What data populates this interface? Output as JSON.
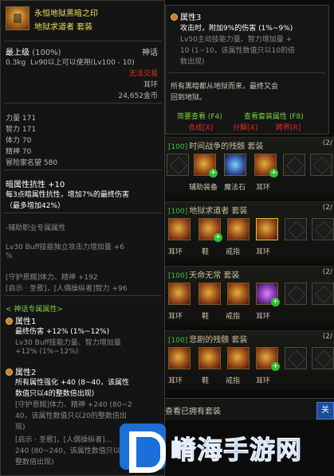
{
  "tooltip": {
    "name": "永恒地狱黑暗之印",
    "set_name": "地狱求道者  套装",
    "grade": "最上级",
    "grade_pct": "(100%)",
    "rarity": "神话",
    "weight": "0.3kg",
    "level_req": "Lv90以上可以使用(Lv100 - 10)",
    "trade": "无法交易",
    "slot_type": "耳环",
    "price": "24,652金币",
    "stats": [
      {
        "label": "力量",
        "value": "171"
      },
      {
        "label": "智力",
        "value": "171"
      },
      {
        "label": "体力",
        "value": "70"
      },
      {
        "label": "精神",
        "value": "70"
      },
      {
        "label": "冒险家名望",
        "value": "580"
      }
    ],
    "dark_res": "暗属性抗性 +10",
    "dark_desc1": "每3点暗属性抗性，增加7%的最终伤害",
    "dark_desc2": "（最多增加42%）",
    "job_header": "-辅助职业专属属性",
    "buff1": "Lv30 Buff技能独立攻击力增加量 +6",
    "buff1b": "%",
    "buff2": "[守护恩赐]体力、精神 +192",
    "buff3": "[启示 · 圣歌]，[人偶操纵者]智力 +96",
    "inherit_header": "< 神话专属属性>",
    "attr1_title": "属性1",
    "attr1_l1": "最终伤害 +12% (1%~12%)",
    "attr1_l2": "Lv30 Buff技能力量、智力增加量",
    "attr1_l3": "+12% (1%~12%)",
    "attr2_title": "属性2",
    "attr2_l1": "所有属性强化 +40 (8~40，该属性",
    "attr2_l2": "数值只以4的整数倍出现)",
    "attr2_l3": "[守护恩赐]体力、精神 +240 (80~2",
    "attr2_l4": "40，该属性数值只以20的整数倍出",
    "attr2_l5": "现)",
    "attr2_l6": "[启示 · 圣歌]，[人偶操纵者]...",
    "attr2_l7": "240 (80~240，该属性数值只以...",
    "attr2_l8": "整数倍出现)"
  },
  "right_tooltip": {
    "attr3_title": "属性3",
    "l1": "攻击时，附加9%的伤害 (1%~9%)",
    "l2": "Lv50主动技能力量、智力增加量 +",
    "l3": "10 (1~10，该属性数值只以10的倍",
    "l4": "数出现)",
    "flavor1": "所有黑暗都从地狱而来，最终又会",
    "flavor2": "回到地狱。",
    "link_brief": "简要查看 (F4)",
    "link_set": "查看套装属性 (F8)",
    "btn_synth": "合成[X]",
    "btn_split": "分解[X]",
    "btn_cross": "跨界[R]"
  },
  "sets": [
    {
      "level": "[100]",
      "name": "时间战争的残骸  套装",
      "count": "(2/",
      "labels": [
        "辅助装备",
        "魔法石",
        "耳环"
      ]
    },
    {
      "level": "[100]",
      "name": "地狱求道者  套装",
      "count": "(2/",
      "labels": [
        "耳环",
        "鞋",
        "戒指",
        "耳环"
      ]
    },
    {
      "level": "[100]",
      "name": "天命无常  套装",
      "count": "(2/",
      "labels": [
        "耳环",
        "鞋",
        "戒指",
        "耳环"
      ]
    },
    {
      "level": "[100]",
      "name": "悲剧的残骸  套装",
      "count": "(2/",
      "labels": [
        "耳环",
        "鞋",
        "戒指",
        "耳环"
      ]
    }
  ],
  "bottom": {
    "text": "查看已拥有套装",
    "button": "关"
  },
  "watermark": "嵴海手游网",
  "colors": {
    "gold": "#e6e060",
    "red": "#e03020",
    "green": "#7ad040",
    "accent": "#1a70d8"
  }
}
